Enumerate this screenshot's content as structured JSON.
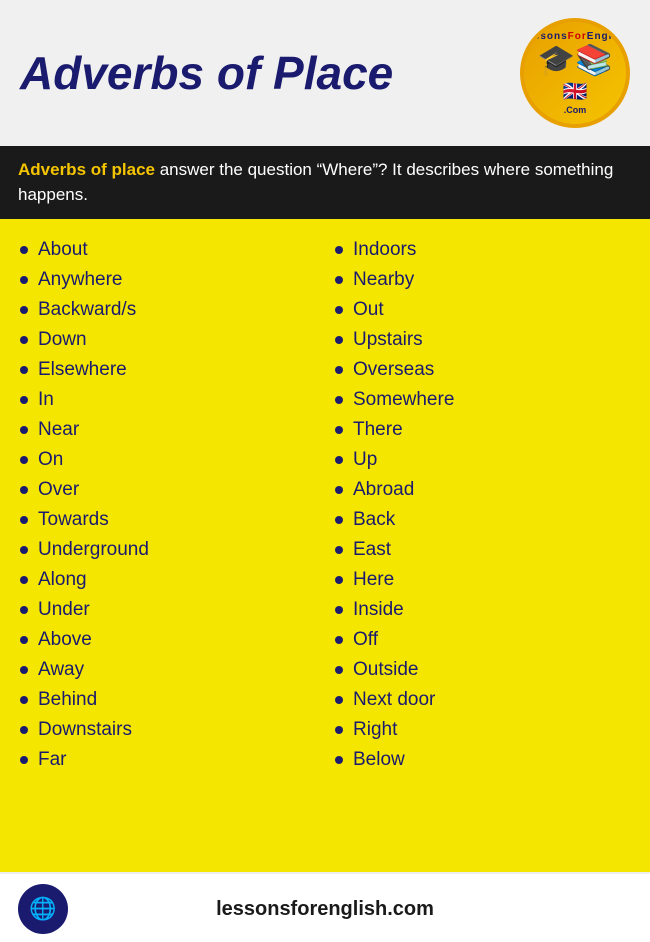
{
  "header": {
    "title": "Adverbs of Place",
    "logo_alt": "LessonsForEnglish.com"
  },
  "description": {
    "highlight": "Adverbs of place",
    "rest": " answer the question “Where”? It describes where something happens."
  },
  "left_column": {
    "items": [
      "About",
      "Anywhere",
      "Backward/s",
      "Down",
      "Elsewhere",
      "In",
      "Near",
      "On",
      "Over",
      "Towards",
      "Underground",
      "Along",
      "Under",
      "Above",
      "Away",
      "Behind",
      "Downstairs",
      "Far"
    ]
  },
  "right_column": {
    "items": [
      "Indoors",
      "Nearby",
      "Out",
      "Upstairs",
      "Overseas",
      "Somewhere",
      "There",
      "Up",
      "Abroad",
      "Back",
      "East",
      "Here",
      "Inside",
      "Off",
      "Outside",
      "Next door",
      "Right",
      "Below"
    ]
  },
  "footer": {
    "url": "lessonsforenglish.com"
  }
}
